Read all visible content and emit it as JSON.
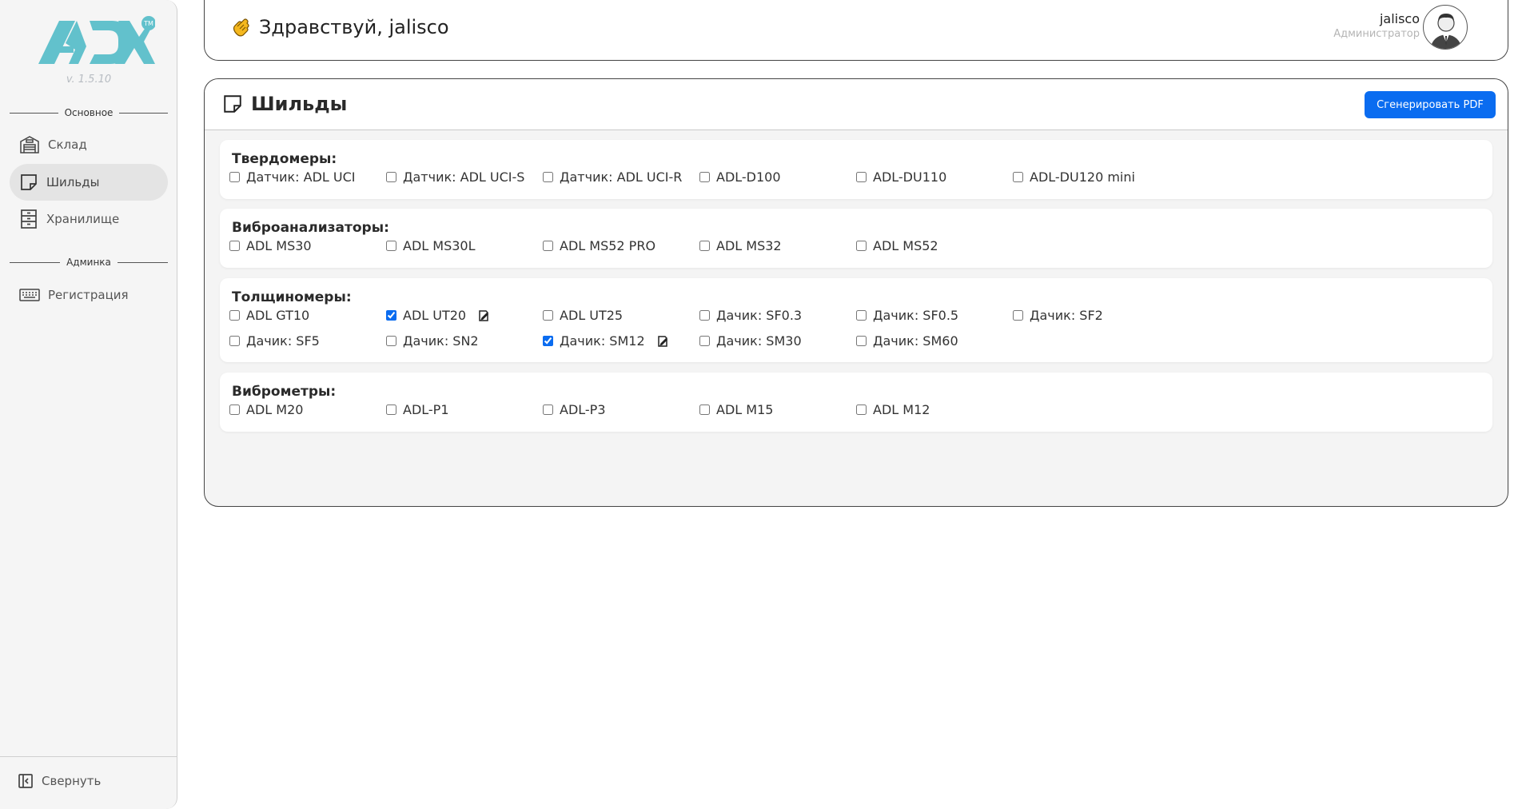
{
  "sidebar": {
    "version": "v. 1.5.10",
    "sections": [
      {
        "label": "Основное"
      },
      {
        "label": "Админка"
      }
    ],
    "items": [
      {
        "label": "Склад",
        "icon": "warehouse-icon",
        "active": false
      },
      {
        "label": "Шильды",
        "icon": "sticky-note-icon",
        "active": true
      },
      {
        "label": "Хранилище",
        "icon": "cabinet-icon",
        "active": false
      },
      {
        "label": "Регистрация",
        "icon": "keyboard-icon",
        "active": false
      }
    ],
    "collapse_label": "Свернуть"
  },
  "header": {
    "greeting": "Здравствуй, jalisco",
    "user_name": "jalisco",
    "user_role": "Администратор"
  },
  "main": {
    "title": "Шильды",
    "pdf_button": "Сгенерировать PDF",
    "groups": [
      {
        "title": "Твердомеры:",
        "options": [
          {
            "label": "Датчик: ADL UCI",
            "checked": false
          },
          {
            "label": "Датчик: ADL UCI-S",
            "checked": false
          },
          {
            "label": "Датчик: ADL UCI-R",
            "checked": false
          },
          {
            "label": "ADL-D100",
            "checked": false
          },
          {
            "label": "ADL-DU110",
            "checked": false
          },
          {
            "label": "ADL-DU120 mini",
            "checked": false
          }
        ]
      },
      {
        "title": "Виброанализаторы:",
        "options": [
          {
            "label": "ADL MS30",
            "checked": false
          },
          {
            "label": "ADL MS30L",
            "checked": false
          },
          {
            "label": "ADL MS52 PRO",
            "checked": false
          },
          {
            "label": "ADL MS32",
            "checked": false
          },
          {
            "label": "ADL MS52",
            "checked": false
          }
        ]
      },
      {
        "title": "Толщиномеры:",
        "options": [
          {
            "label": "ADL GT10",
            "checked": false
          },
          {
            "label": "ADL UT20",
            "checked": true
          },
          {
            "label": "ADL UT25",
            "checked": false
          },
          {
            "label": "Дачик: SF0.3",
            "checked": false
          },
          {
            "label": "Дачик: SF0.5",
            "checked": false
          },
          {
            "label": "Дачик: SF2",
            "checked": false
          },
          {
            "label": "Дачик: SF5",
            "checked": false
          },
          {
            "label": "Дачик: SN2",
            "checked": false
          },
          {
            "label": "Дачик: SM12",
            "checked": true
          },
          {
            "label": "Дачик: SM30",
            "checked": false
          },
          {
            "label": "Дачик: SM60",
            "checked": false
          }
        ]
      },
      {
        "title": "Виброметры:",
        "options": [
          {
            "label": "ADL M20",
            "checked": false
          },
          {
            "label": "ADL-P1",
            "checked": false
          },
          {
            "label": "ADL-P3",
            "checked": false
          },
          {
            "label": "ADL M15",
            "checked": false
          },
          {
            "label": "ADL M12",
            "checked": false
          }
        ]
      }
    ]
  },
  "colors": {
    "accent": "#0a6cf0",
    "logo": "#62c1cc",
    "sidebar_bg": "#f5f5f5",
    "active_item_bg": "#e4e4e4",
    "content_bg": "#f4f4f4"
  }
}
